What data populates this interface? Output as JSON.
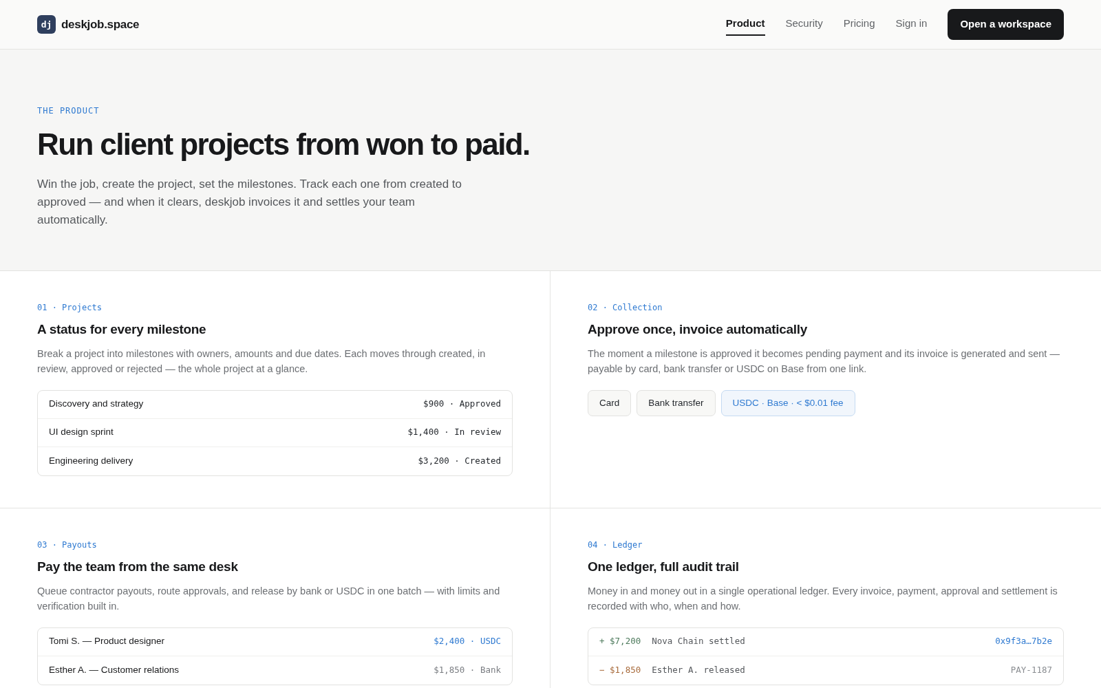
{
  "brand": {
    "logo": "dj",
    "name": "deskjob.space"
  },
  "nav": [
    {
      "label": "Product",
      "selected": true
    },
    {
      "label": "Security",
      "selected": false
    },
    {
      "label": "Pricing",
      "selected": false
    },
    {
      "label": "Sign in",
      "selected": false
    }
  ],
  "cta": "Open a workspace",
  "hero": {
    "eyebrow": "THE PRODUCT",
    "title": "Run client projects from won to paid.",
    "lead": "Win the job, create the project, set the milestones. Track each one from created to approved — and when it clears, deskjob invoices it and settles your team automatically."
  },
  "features": [
    {
      "tag": "01 · Projects",
      "title": "A status for every milestone",
      "body": "Break a project into milestones with owners, amounts and due dates. Each moves through created, in review, approved or rejected — the whole project at a glance.",
      "kind": "rows",
      "rows": [
        {
          "name": "Discovery and strategy",
          "value": "$900 · Approved",
          "color": "#1f2328"
        },
        {
          "name": "UI design sprint",
          "value": "$1,400 · In review",
          "color": "#1f2328"
        },
        {
          "name": "Engineering delivery",
          "value": "$3,200 · Created",
          "color": "#1f2328"
        }
      ]
    },
    {
      "tag": "02 · Collection",
      "title": "Approve once, invoice automatically",
      "body": "The moment a milestone is approved it becomes pending payment and its invoice is generated and sent — payable by card, bank transfer or USDC on Base from one link.",
      "kind": "chips",
      "chips": [
        {
          "label": "Card",
          "selected": false
        },
        {
          "label": "Bank transfer",
          "selected": false
        },
        {
          "label": "USDC · Base · < $0.01 fee",
          "selected": true
        }
      ]
    },
    {
      "tag": "03 · Payouts",
      "title": "Pay the team from the same desk",
      "body": "Queue contractor payouts, route approvals, and release by bank or USDC in one batch — with limits and verification built in.",
      "kind": "rows",
      "rows": [
        {
          "name": "Tomi S. — Product designer",
          "value": "$2,400 · USDC",
          "color": "#2f7ad1"
        },
        {
          "name": "Esther A. — Customer relations",
          "value": "$1,850 · Bank",
          "color": "#7a7d82"
        }
      ]
    },
    {
      "tag": "04 · Ledger",
      "title": "One ledger, full audit trail",
      "body": "Money in and money out in a single operational ledger. Every invoice, payment, approval and settlement is recorded with who, when and how.",
      "kind": "ledger",
      "entries": [
        {
          "amount": "+ $7,200",
          "color": "#4d7a5c",
          "text": "Nova Chain settled",
          "ref": "0x9f3a…7b2e",
          "linked": true
        },
        {
          "amount": "− $1,850",
          "color": "#a86b3c",
          "text": "Esther A. released",
          "ref": "PAY-1187",
          "linked": false
        }
      ]
    }
  ]
}
